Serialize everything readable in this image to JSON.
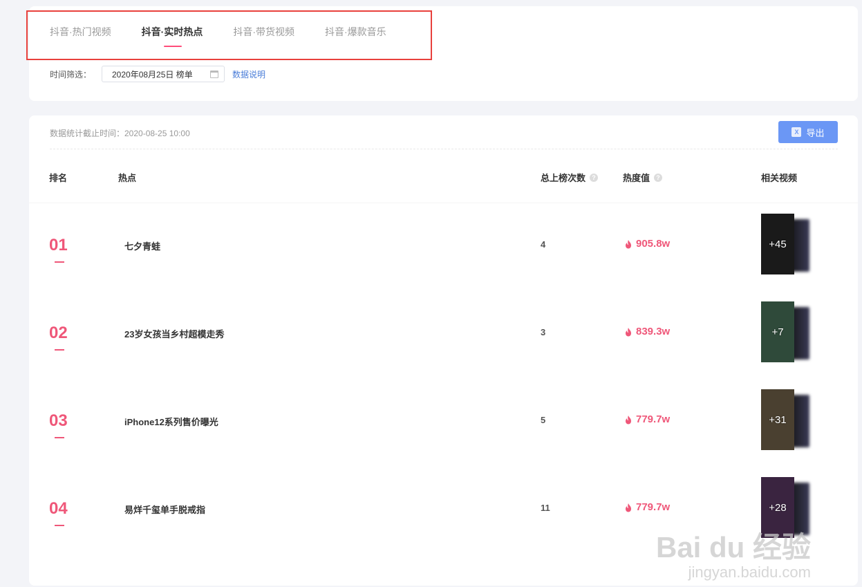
{
  "tabs": [
    {
      "label": "抖音·热门视频",
      "active": false
    },
    {
      "label": "抖音·实时热点",
      "active": true
    },
    {
      "label": "抖音·带货视频",
      "active": false
    },
    {
      "label": "抖音·爆款音乐",
      "active": false
    }
  ],
  "filter": {
    "label": "时间筛选：",
    "date_value": "2020年08月25日 榜单",
    "data_note": "数据说明"
  },
  "stats": {
    "time_text": "数据统计截止时间：2020-08-25 10:00",
    "export_label": "导出"
  },
  "table": {
    "headers": {
      "rank": "排名",
      "topic": "热点",
      "count": "总上榜次数",
      "heat": "热度值",
      "videos": "相关视频"
    },
    "rows": [
      {
        "rank": "01",
        "topic": "七夕青蛙",
        "count": "4",
        "heat": "905.8w",
        "video_count": "+45",
        "thumb_color": "#1a1a1a"
      },
      {
        "rank": "02",
        "topic": "23岁女孩当乡村超模走秀",
        "count": "3",
        "heat": "839.3w",
        "video_count": "+7",
        "thumb_color": "#2f4a3a"
      },
      {
        "rank": "03",
        "topic": "iPhone12系列售价曝光",
        "count": "5",
        "heat": "779.7w",
        "video_count": "+31",
        "thumb_color": "#4a4030"
      },
      {
        "rank": "04",
        "topic": "易烊千玺单手脱戒指",
        "count": "11",
        "heat": "779.7w",
        "video_count": "+28",
        "thumb_color": "#3a2440"
      }
    ]
  },
  "watermark": {
    "main": "Bai du 经验",
    "sub": "jingyan.baidu.com"
  },
  "colors": {
    "accent": "#ef5779",
    "export_button": "#6b97f5",
    "link": "#4a7dd8",
    "highlight_border": "#e8403c"
  }
}
